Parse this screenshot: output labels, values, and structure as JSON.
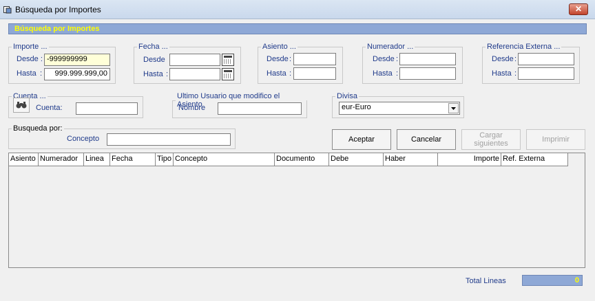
{
  "window": {
    "title": "Búsqueda por Importes",
    "close_label": "✕"
  },
  "header": {
    "title": "Búsqueda por Importes"
  },
  "importe": {
    "legend": "Importe ...",
    "desde_label": "Desde :",
    "desde_value": "-999999999",
    "hasta_label": "Hasta",
    "hasta_colon": ":",
    "hasta_value": "999.999.999,00"
  },
  "fecha": {
    "legend": "Fecha ...",
    "desde_label": "Desde",
    "hasta_label": "Hasta",
    "colon": ":"
  },
  "asiento": {
    "legend": "Asiento ...",
    "desde_label": "Desde",
    "hasta_label": "Hasta",
    "colon": ":"
  },
  "numerador": {
    "legend": "Numerador ...",
    "desde_label": "Desde",
    "hasta_label": "Hasta",
    "colon": ":"
  },
  "referencia": {
    "legend": "Referencia Externa ...",
    "desde_label": "Desde",
    "hasta_label": "Hasta",
    "colon": ":"
  },
  "cuenta": {
    "legend": "Cuenta ...",
    "label": "Cuenta:"
  },
  "usuario": {
    "legend": "Ultimo Usuario que modifico el Asiento",
    "label": "Nombre"
  },
  "divisa": {
    "legend": "Divisa",
    "selected": "eur-Euro"
  },
  "busqueda": {
    "legend": "Busqueda por:",
    "concepto_label": "Concepto"
  },
  "buttons": {
    "aceptar": "Aceptar",
    "cancelar": "Cancelar",
    "cargar_line1": "Cargar",
    "cargar_line2": "siguientes",
    "imprimir": "Imprimir"
  },
  "grid": {
    "columns": [
      "Asiento",
      "Numerador",
      "Linea",
      "Fecha",
      "Tipo",
      "Concepto",
      "Documento",
      "Debe",
      "Haber",
      "Importe",
      "Ref. Externa"
    ]
  },
  "footer": {
    "total_label": "Total Lineas",
    "total_value": "0"
  }
}
